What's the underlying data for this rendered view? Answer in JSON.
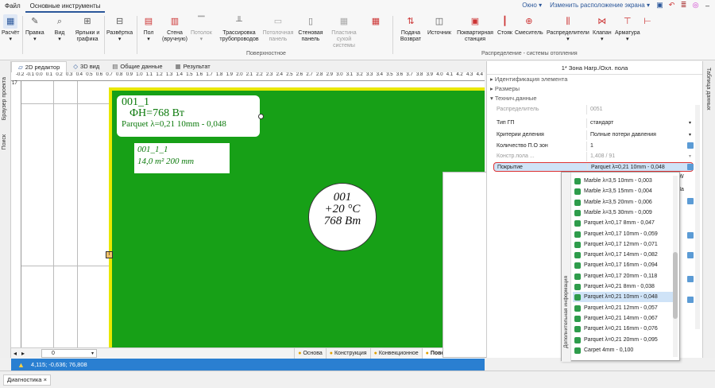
{
  "menubar": {
    "items": [
      "Файл",
      "Основные инструменты"
    ],
    "window_label": "Окно",
    "layout_label": "Изменить расположение экрана"
  },
  "ribbon": {
    "buttons": [
      {
        "label": "Расчёт",
        "icon": "calculator-icon",
        "disabled": false
      },
      {
        "label": "Правка",
        "icon": "edit-icon",
        "disabled": false
      },
      {
        "label": "Вид",
        "icon": "view-icon",
        "disabled": false
      },
      {
        "label": "Ярлыки и графика",
        "icon": "labels-icon",
        "disabled": false
      },
      {
        "label": "Развёртка",
        "icon": "unfold-icon",
        "disabled": false
      },
      {
        "label": "Пол",
        "icon": "floor-icon",
        "disabled": false
      },
      {
        "label": "Стена (вручную)",
        "icon": "wall-icon",
        "disabled": false
      },
      {
        "label": "Потолок",
        "icon": "ceiling-icon",
        "disabled": true
      },
      {
        "label": "Трассировка трубопроводов",
        "icon": "pipe-routing-icon",
        "disabled": false
      },
      {
        "label": "Потолочная панель",
        "icon": "ceiling-panel-icon",
        "disabled": true
      },
      {
        "label": "Стеновая панель",
        "icon": "wall-panel-icon",
        "disabled": false
      },
      {
        "label": "Пластина сухой системы",
        "icon": "dry-plate-icon",
        "disabled": true
      },
      {
        "label": "Подача Возврат",
        "icon": "supply-return-icon",
        "disabled": false
      },
      {
        "label": "Источник",
        "icon": "source-icon",
        "disabled": false
      },
      {
        "label": "Поквартирная станция",
        "icon": "station-icon",
        "disabled": false
      },
      {
        "label": "Стояк",
        "icon": "riser-icon",
        "disabled": false
      },
      {
        "label": "Смеситель",
        "icon": "mixer-icon",
        "disabled": false
      },
      {
        "label": "Распределители",
        "icon": "distributor-icon",
        "disabled": false
      },
      {
        "label": "Клапан",
        "icon": "valve-icon",
        "disabled": false
      },
      {
        "label": "Арматура",
        "icon": "fitting-icon",
        "disabled": false
      }
    ],
    "group_surface": "Поверхностное",
    "group_distribution": "Распределение - системы отопления"
  },
  "doc_tabs": [
    "2D редактор",
    "3D вид",
    "Общие данные",
    "Результат"
  ],
  "left_strip": {
    "a": "Браузер проекта",
    "b": "Поиск"
  },
  "ruler_labels": [
    "-0.2",
    "-0.1",
    "0.0",
    "0.1",
    "0.2",
    "0.3",
    "0.4",
    "0.5",
    "0.6",
    "0.7",
    "0.8",
    "0.9",
    "1.0",
    "1.1",
    "1.2",
    "1.3",
    "1.4",
    "1.5",
    "1.6",
    "1.7",
    "1.8",
    "1.9",
    "2.0",
    "2.1",
    "2.2",
    "2.3",
    "2.4",
    "2.5",
    "2.6",
    "2.7",
    "2.8",
    "2.9",
    "3.0",
    "3.1",
    "3.2",
    "3.3",
    "3.4",
    "3.5",
    "3.6",
    "3.7",
    "3.8",
    "3.9",
    "4.0",
    "4.1",
    "4.2",
    "4.3",
    "4.4"
  ],
  "ruler_left_label": "17",
  "canvas": {
    "label1_line1": "001_1",
    "label1_line2": "ФН=768 Вт",
    "label1_line3": "Parquet λ=0,21 10mm - 0,048",
    "label2_line1": "001_1_1",
    "label2_line2": "14,0 m²    200 mm",
    "circle_line1": "001",
    "circle_line2": "+20 °C",
    "circle_line3": "768 Вт",
    "marker": "T"
  },
  "canvas_bottom": {
    "zoom_value": "0",
    "layers": [
      "Основа",
      "Конструкция",
      "Конвекционное",
      "Поверхн.-пол,стен"
    ]
  },
  "status": {
    "coords": "4,115; -0,636; 76,808"
  },
  "bottom_tab": "Диагностика",
  "right_panel": {
    "title": "1* Зона Нагр./Охл. пола",
    "categories": [
      "Идентификация элемента",
      "Размеры",
      "Технич.данные"
    ],
    "props": [
      {
        "name": "Распределитель",
        "value": "0051",
        "dim": true
      },
      {
        "name": "Тип ГП",
        "value": "стандарт",
        "dim": false
      },
      {
        "name": "Критерии деления",
        "value": "Полные потери давления",
        "dim": false
      },
      {
        "name": "Количество П.О зон",
        "value": "1",
        "dim": false
      },
      {
        "name": "Констр.пола ...",
        "value": "1,408 / 91",
        "dim": true
      },
      {
        "name": "Покрытие",
        "value": "Parquet λ=0,21 10mm - 0,048",
        "dim": false
      }
    ],
    "side_tab": "Таблица данных",
    "cut_text_1": "W",
    "cut_text_2": "Па"
  },
  "dropdown": {
    "side_label": "Дополнительная информация",
    "items": [
      "Marble λ=3,5 10mm - 0,003",
      "Marble λ=3,5 15mm - 0,004",
      "Marble λ=3,5 20mm - 0,006",
      "Marble λ=3,5 30mm - 0,009",
      "Parquet λ=0,17 8mm - 0,047",
      "Parquet λ=0,17 10mm - 0,059",
      "Parquet λ=0,17 12mm - 0,071",
      "Parquet λ=0,17 14mm - 0,082",
      "Parquet λ=0,17 16mm - 0,094",
      "Parquet λ=0,17 20mm - 0,118",
      "Parquet λ=0,21 8mm - 0,038",
      "Parquet λ=0,21 10mm - 0,048",
      "Parquet λ=0,21 12mm - 0,057",
      "Parquet λ=0,21 14mm - 0,067",
      "Parquet λ=0,21 16mm - 0,076",
      "Parquet λ=0,21 20mm - 0,095",
      "Carpet 4mm - 0,100"
    ],
    "selected_index": 11
  },
  "colors": {
    "floor_green": "#17a017",
    "status_blue": "#2a7fd1",
    "selection": "#cfe3f7",
    "accent": "#2b579a"
  }
}
